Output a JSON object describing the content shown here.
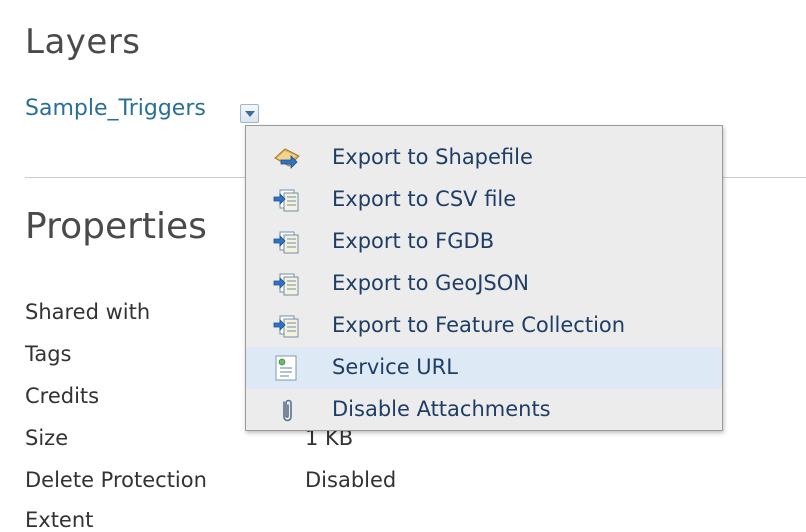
{
  "layers_heading": "Layers",
  "layer": {
    "name": "Sample_Triggers"
  },
  "properties_heading": "Properties",
  "properties": [
    {
      "label": "Shared with",
      "value": ""
    },
    {
      "label": "Tags",
      "value": ""
    },
    {
      "label": "Credits",
      "value": ""
    },
    {
      "label": "Size",
      "value": "1 KB"
    },
    {
      "label": "Delete Protection",
      "value": "Disabled"
    },
    {
      "label": "Extent",
      "value": ""
    }
  ],
  "menu": {
    "items": [
      {
        "label": "Export to Shapefile",
        "icon": "shapefile-export-icon"
      },
      {
        "label": "Export to CSV file",
        "icon": "csv-export-icon"
      },
      {
        "label": "Export to FGDB",
        "icon": "fgdb-export-icon"
      },
      {
        "label": "Export to GeoJSON",
        "icon": "geojson-export-icon"
      },
      {
        "label": "Export to Feature Collection",
        "icon": "feature-collection-export-icon"
      },
      {
        "label": "Service URL",
        "icon": "service-url-icon",
        "highlighted": true
      },
      {
        "label": "Disable Attachments",
        "icon": "paperclip-icon"
      }
    ]
  },
  "colors": {
    "link": "#2a6f97",
    "menu_text": "#1f3e66",
    "menu_bg": "#ececec",
    "menu_highlight": "#dde9f4"
  }
}
